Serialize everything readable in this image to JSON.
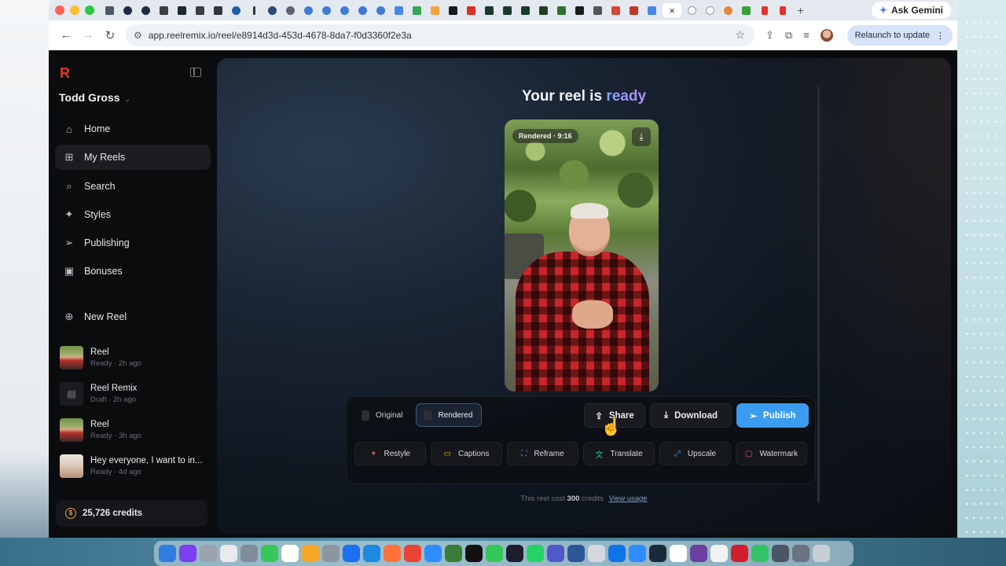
{
  "browser": {
    "url": "app.reelremix.io/reel/e8914d3d-453d-4678-8da7-f0d3360f2e3a",
    "ask_gemini": "Ask Gemini",
    "relaunch": "Relaunch to update",
    "tab_close": "×"
  },
  "sidebar": {
    "user_name": "Todd Gross",
    "nav": [
      {
        "label": "Home",
        "icon": "home-icon"
      },
      {
        "label": "My Reels",
        "icon": "grid-icon"
      },
      {
        "label": "Search",
        "icon": "search-icon"
      },
      {
        "label": "Styles",
        "icon": "sparkle-icon"
      },
      {
        "label": "Publishing",
        "icon": "send-icon"
      },
      {
        "label": "Bonuses",
        "icon": "gift-icon"
      }
    ],
    "new_reel": "New Reel",
    "recent": [
      {
        "title": "Reel",
        "meta": "Ready · 2h ago"
      },
      {
        "title": "Reel Remix",
        "meta": "Draft · 2h ago"
      },
      {
        "title": "Reel",
        "meta": "Ready · 3h ago"
      },
      {
        "title": "Hey everyone, I want to in...",
        "meta": "Ready · 4d ago"
      }
    ],
    "credits": "25,726 credits"
  },
  "main": {
    "heading_prefix": "Your reel is",
    "heading_highlight": "ready",
    "video_badge": "Rendered · 9:16",
    "view_original": "Original",
    "view_rendered": "Rendered",
    "share": "Share",
    "download": "Download",
    "publish": "Publish",
    "tools": [
      "Restyle",
      "Captions",
      "Reframe",
      "Translate",
      "Upscale",
      "Watermark"
    ],
    "cost_prefix": "This reel cost",
    "cost_amount": "300",
    "cost_suffix": "credits",
    "view_usage": "View usage"
  },
  "colors": {
    "brand_red": "#e3322b",
    "accent_blue": "#3a9cf0",
    "background": "#0b0c0e"
  }
}
